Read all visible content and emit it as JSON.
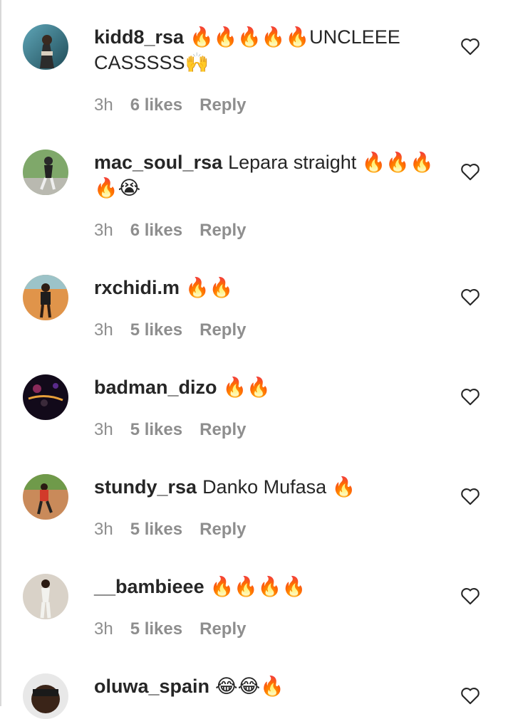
{
  "comments": [
    {
      "username": "kidd8_rsa",
      "text": "🔥🔥🔥🔥🔥UNCLEEE CASSSSS🙌",
      "time": "3h",
      "likes": "6 likes",
      "reply": "Reply"
    },
    {
      "username": "mac_soul_rsa",
      "text": "Lepara straight 🔥🔥🔥🔥😭",
      "time": "3h",
      "likes": "6 likes",
      "reply": "Reply"
    },
    {
      "username": "rxchidi.m",
      "text": "🔥🔥",
      "time": "3h",
      "likes": "5 likes",
      "reply": "Reply"
    },
    {
      "username": "badman_dizo",
      "text": "🔥🔥",
      "time": "3h",
      "likes": "5 likes",
      "reply": "Reply"
    },
    {
      "username": "stundy_rsa",
      "text": "Danko Mufasa 🔥",
      "time": "3h",
      "likes": "5 likes",
      "reply": "Reply"
    },
    {
      "username": "__bambieee",
      "text": "🔥🔥🔥🔥",
      "time": "3h",
      "likes": "5 likes",
      "reply": "Reply"
    },
    {
      "username": "oluwa_spain",
      "text": "😂😂🔥",
      "time": "",
      "likes": "",
      "reply": ""
    }
  ],
  "icons": {
    "like": "heart-outline-icon"
  },
  "colors": {
    "username": "#262626",
    "text": "#262626",
    "meta": "#8e8e8e",
    "icon": "#262626"
  }
}
